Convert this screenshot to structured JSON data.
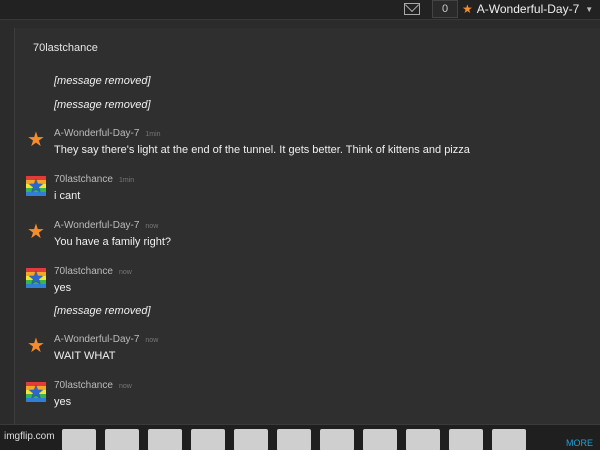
{
  "header": {
    "notifications": "0",
    "username": "A-Wonderful-Day-7"
  },
  "thread": {
    "title": "70lastchance",
    "first": [
      "[message removed]",
      "[message removed]"
    ]
  },
  "messages": [
    {
      "user": "A-Wonderful-Day-7",
      "time": "1min",
      "avatar": "orange-star",
      "lines": [
        "They say there's light at the end of the tunnel. It gets better. Think of kittens and pizza"
      ]
    },
    {
      "user": "70lastchance",
      "time": "1min",
      "avatar": "rainbow-star",
      "lines": [
        "i cant"
      ]
    },
    {
      "user": "A-Wonderful-Day-7",
      "time": "now",
      "avatar": "orange-star",
      "lines": [
        "You have a family right?"
      ]
    },
    {
      "user": "70lastchance",
      "time": "now",
      "avatar": "rainbow-star",
      "lines": [
        "yes",
        "[message removed]"
      ]
    },
    {
      "user": "A-Wonderful-Day-7",
      "time": "now",
      "avatar": "orange-star",
      "lines": [
        "WAIT WHAT"
      ]
    },
    {
      "user": "70lastchance",
      "time": "now",
      "avatar": "rainbow-star",
      "lines": [
        "yes"
      ]
    }
  ],
  "footer": {
    "logo": "imgflip.com",
    "more": "MORE"
  }
}
